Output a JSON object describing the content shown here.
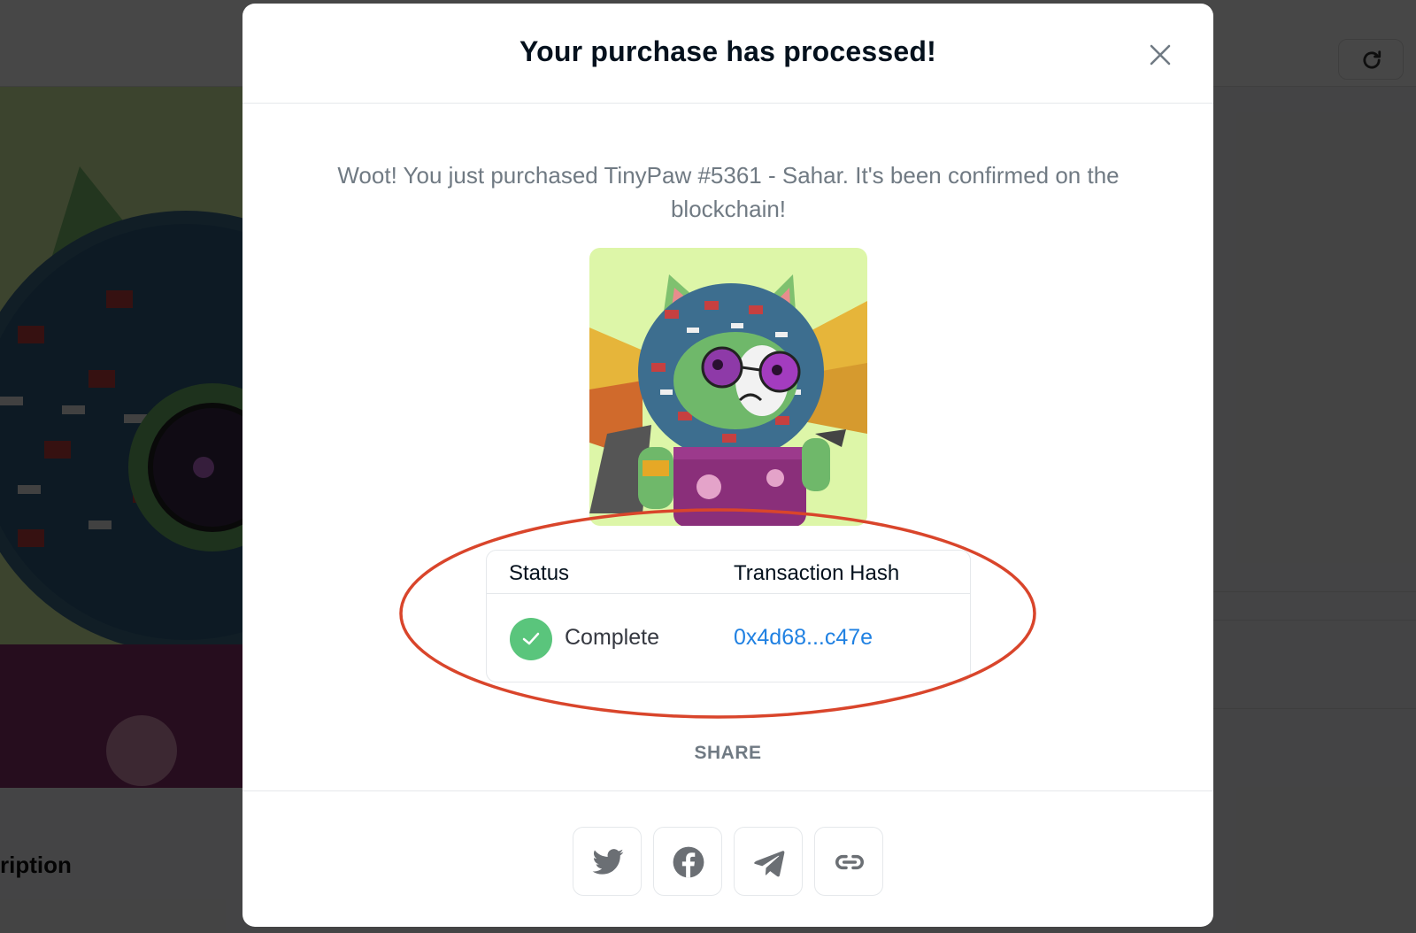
{
  "background": {
    "section_heading": "ription"
  },
  "modal": {
    "title": "Your purchase has processed!",
    "message": "Woot! You just purchased TinyPaw #5361 - Sahar. It's been confirmed on the blockchain!",
    "nft_image_alt": "TinyPaw #5361 - Sahar",
    "table": {
      "headers": {
        "status": "Status",
        "transaction_hash": "Transaction Hash"
      },
      "row": {
        "status": "Complete",
        "transaction_hash": "0x4d68...c47e"
      }
    },
    "share_label": "SHARE",
    "share_buttons": [
      "twitter-icon",
      "facebook-icon",
      "telegram-icon",
      "link-icon"
    ]
  },
  "colors": {
    "accent_link": "#2081e2",
    "status_complete": "#5ac57c",
    "annotation_ellipse": "#d9452b",
    "nft_background": "#ddf6a8"
  }
}
